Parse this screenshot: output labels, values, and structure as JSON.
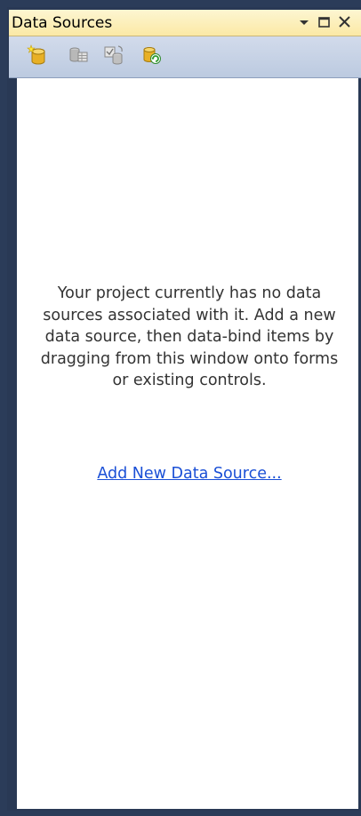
{
  "window": {
    "title": "Data Sources"
  },
  "toolbar": {
    "buttons": [
      {
        "icon": "add-data-source-icon"
      },
      {
        "icon": "edit-dataset-designer-icon"
      },
      {
        "icon": "configure-dataset-icon"
      },
      {
        "icon": "refresh-icon"
      }
    ]
  },
  "content": {
    "message": "Your project currently has no data sources associated with it. Add a new data source, then data-bind items by dragging from this window onto forms or existing controls.",
    "link": "Add New Data Source..."
  },
  "colors": {
    "title_bar": "#fbe9a5",
    "toolbar": "#c8d3e6",
    "frame": "#293955",
    "link": "#1a4fd6"
  }
}
